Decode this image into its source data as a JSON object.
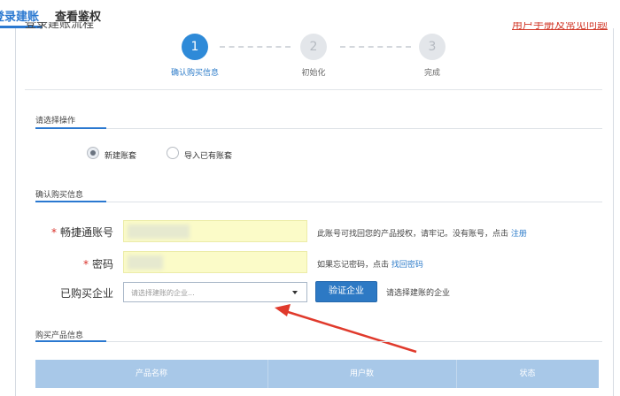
{
  "tabs": [
    {
      "label": "登录建账",
      "active": true
    },
    {
      "label": "查看鉴权",
      "active": false
    }
  ],
  "header_partial": {
    "title": "登录建账流程",
    "link": "用户手册及常见问题"
  },
  "steps": [
    {
      "number": "1",
      "label": "确认购买信息",
      "state": "active"
    },
    {
      "number": "2",
      "label": "初始化",
      "state": "inactive"
    },
    {
      "number": "3",
      "label": "完成",
      "state": "inactive"
    }
  ],
  "operation_section": {
    "title": "请选择操作",
    "options": [
      {
        "label": "新建账套",
        "checked": true
      },
      {
        "label": "导入已有账套",
        "checked": false
      }
    ]
  },
  "purchase_section": {
    "title": "确认购买信息",
    "account_label": "畅捷通账号",
    "account_hint": "此账号可找回您的产品授权，请牢记。没有账号，点击",
    "account_hint_link": "注册",
    "password_label": "密码",
    "password_hint": "如果忘记密码，点击",
    "password_hint_link": "找回密码",
    "company_label": "已购买企业",
    "company_placeholder": "请选择建账的企业...",
    "verify_button": "验证企业",
    "company_hint": "请选择建账的企业"
  },
  "product_section": {
    "title": "购买产品信息",
    "columns": [
      "产品名称",
      "用户数",
      "状态"
    ]
  },
  "colors": {
    "accent": "#2a78d0",
    "required": "#d9312a",
    "annotation_arrow": "#e03a2c",
    "table_header": "#a8c8e8"
  }
}
